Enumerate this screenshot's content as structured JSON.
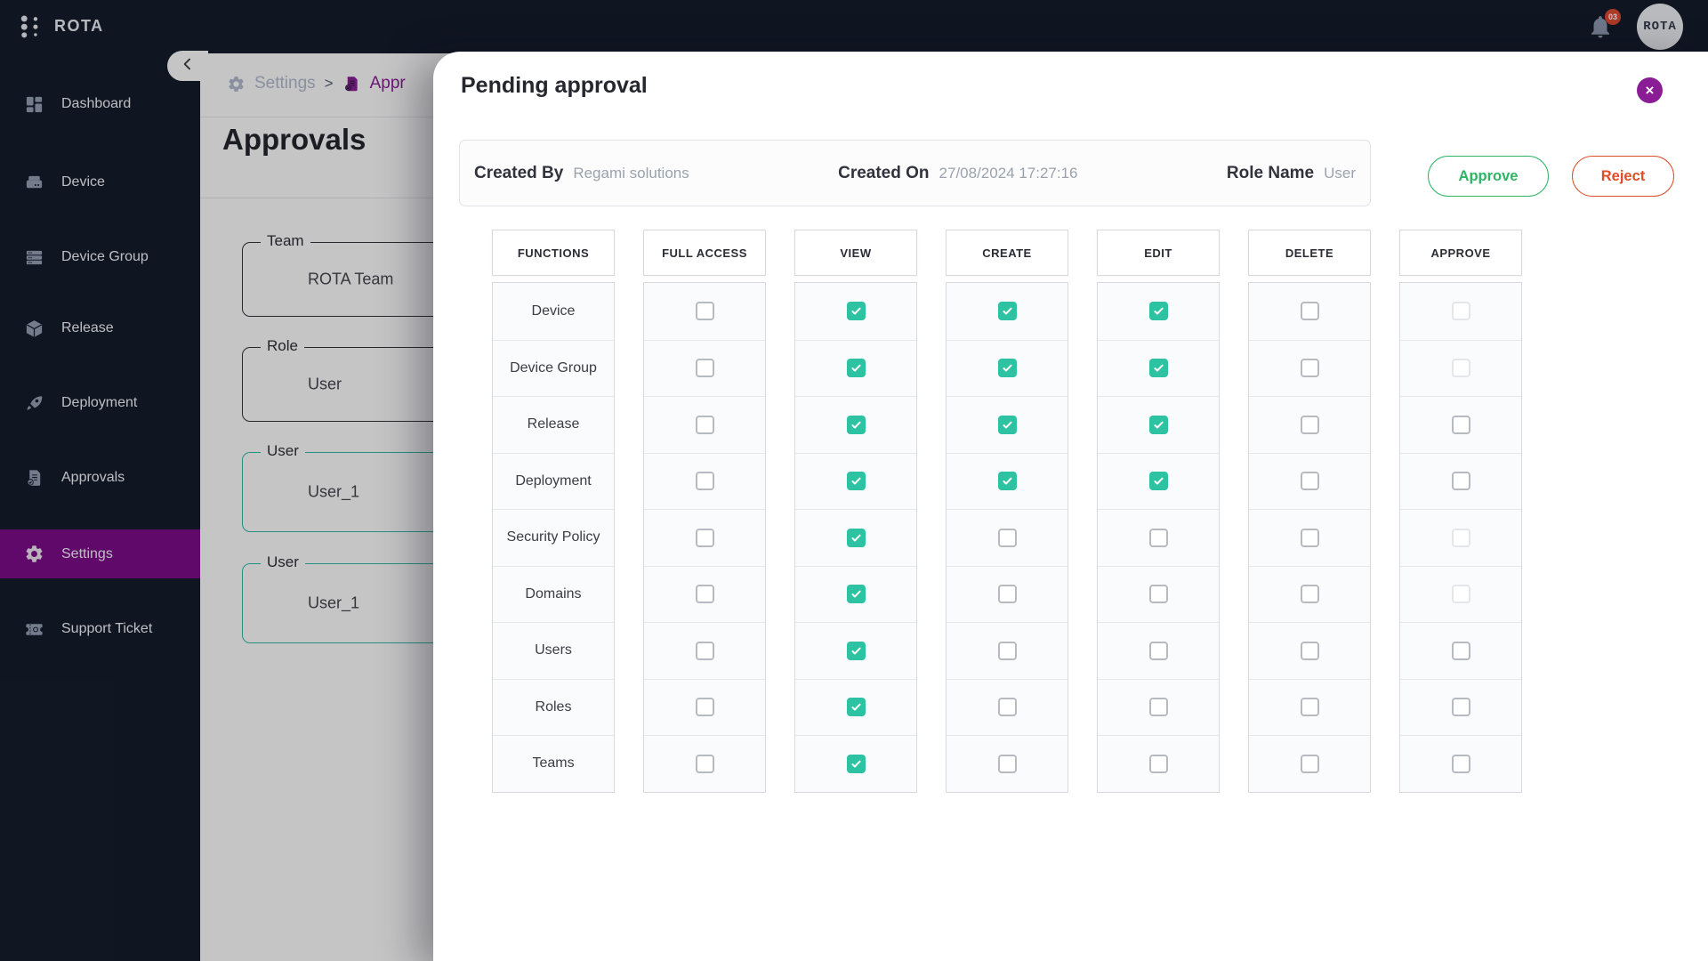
{
  "app": {
    "name": "ROTA",
    "avatar_label": "ROTA",
    "notification_count": "03"
  },
  "sidebar": {
    "items": [
      {
        "label": "Dashboard",
        "icon": "dashboard",
        "active": false
      },
      {
        "label": "Device",
        "icon": "device",
        "active": false
      },
      {
        "label": "Device Group",
        "icon": "device-group",
        "active": false
      },
      {
        "label": "Release",
        "icon": "release",
        "active": false
      },
      {
        "label": "Deployment",
        "icon": "deployment",
        "active": false
      },
      {
        "label": "Approvals",
        "icon": "approvals",
        "active": false
      },
      {
        "label": "Settings",
        "icon": "settings",
        "active": true
      },
      {
        "label": "Support Ticket",
        "icon": "support-ticket",
        "active": false
      }
    ]
  },
  "breadcrumb": {
    "items": [
      {
        "label": "Settings",
        "icon": "settings"
      },
      {
        "label": "Appr",
        "icon": "approvals"
      }
    ],
    "separator": ">"
  },
  "page": {
    "title": "Approvals"
  },
  "background_form": {
    "fields": [
      {
        "label": "Team",
        "value": "ROTA Team",
        "accent": false
      },
      {
        "label": "Role",
        "value": "User",
        "accent": false
      },
      {
        "label": "User",
        "value": "User_1",
        "accent": true
      },
      {
        "label": "User",
        "value": "User_1",
        "accent": true
      }
    ]
  },
  "modal": {
    "title": "Pending approval",
    "info": {
      "created_by_label": "Created By",
      "created_by": "Regami solutions",
      "created_on_label": "Created On",
      "created_on": "27/08/2024 17:27:16",
      "role_name_label": "Role Name",
      "role_name": "User"
    },
    "actions": {
      "approve": "Approve",
      "reject": "Reject"
    },
    "table": {
      "columns": [
        "FUNCTIONS",
        "FULL ACCESS",
        "VIEW",
        "CREATE",
        "EDIT",
        "DELETE",
        "APPROVE"
      ],
      "rows": [
        {
          "function": "Device",
          "states": [
            "unchecked",
            "checked",
            "checked",
            "checked",
            "unchecked",
            "disabled"
          ]
        },
        {
          "function": "Device Group",
          "states": [
            "unchecked",
            "checked",
            "checked",
            "checked",
            "unchecked",
            "disabled"
          ]
        },
        {
          "function": "Release",
          "states": [
            "unchecked",
            "checked",
            "checked",
            "checked",
            "unchecked",
            "unchecked"
          ]
        },
        {
          "function": "Deployment",
          "states": [
            "unchecked",
            "checked",
            "checked",
            "checked",
            "unchecked",
            "unchecked"
          ]
        },
        {
          "function": "Security Policy",
          "states": [
            "unchecked",
            "checked",
            "unchecked",
            "unchecked",
            "unchecked",
            "disabled"
          ]
        },
        {
          "function": "Domains",
          "states": [
            "unchecked",
            "checked",
            "unchecked",
            "unchecked",
            "unchecked",
            "disabled"
          ]
        },
        {
          "function": "Users",
          "states": [
            "unchecked",
            "checked",
            "unchecked",
            "unchecked",
            "unchecked",
            "unchecked"
          ]
        },
        {
          "function": "Roles",
          "states": [
            "unchecked",
            "checked",
            "unchecked",
            "unchecked",
            "unchecked",
            "unchecked"
          ]
        },
        {
          "function": "Teams",
          "states": [
            "unchecked",
            "checked",
            "unchecked",
            "unchecked",
            "unchecked",
            "unchecked"
          ]
        }
      ]
    }
  },
  "colors": {
    "brand_purple": "#8A1D96",
    "active_purple": "#7C0A88",
    "teal_checked": "#2CC2A2",
    "approve_green": "#2DB563",
    "reject_red": "#DC4E27",
    "badge_red": "#E0492F",
    "sidebar_bg": "#131A29",
    "accent_teal_border": "#30BCA6"
  }
}
